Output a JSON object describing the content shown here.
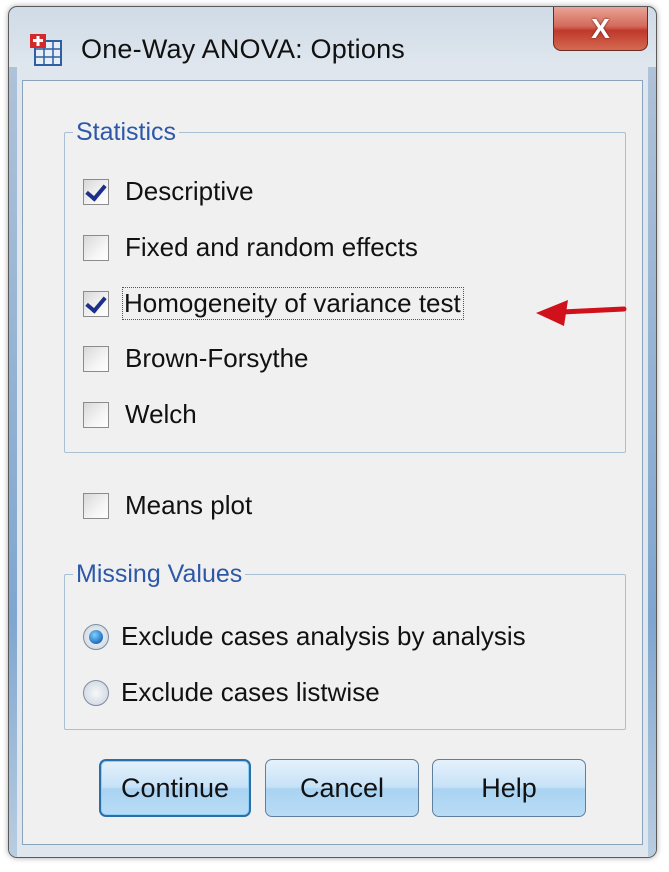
{
  "window": {
    "title": "One-Way ANOVA: Options",
    "close_glyph": "X",
    "icon": "spss-table-icon"
  },
  "statistics": {
    "legend": "Statistics",
    "items": [
      {
        "label": "Descriptive",
        "checked": true
      },
      {
        "label": "Fixed and random effects",
        "checked": false
      },
      {
        "label": "Homogeneity of variance test",
        "checked": true,
        "focused": true
      },
      {
        "label": "Brown-Forsythe",
        "checked": false
      },
      {
        "label": "Welch",
        "checked": false
      }
    ]
  },
  "means_plot": {
    "label": "Means plot",
    "checked": false
  },
  "missing_values": {
    "legend": "Missing Values",
    "options": [
      {
        "label": "Exclude cases analysis by analysis",
        "selected": true
      },
      {
        "label": "Exclude cases listwise",
        "selected": false
      }
    ]
  },
  "buttons": {
    "continue": "Continue",
    "cancel": "Cancel",
    "help": "Help"
  },
  "annotation": {
    "arrow_color": "#d0101a"
  }
}
